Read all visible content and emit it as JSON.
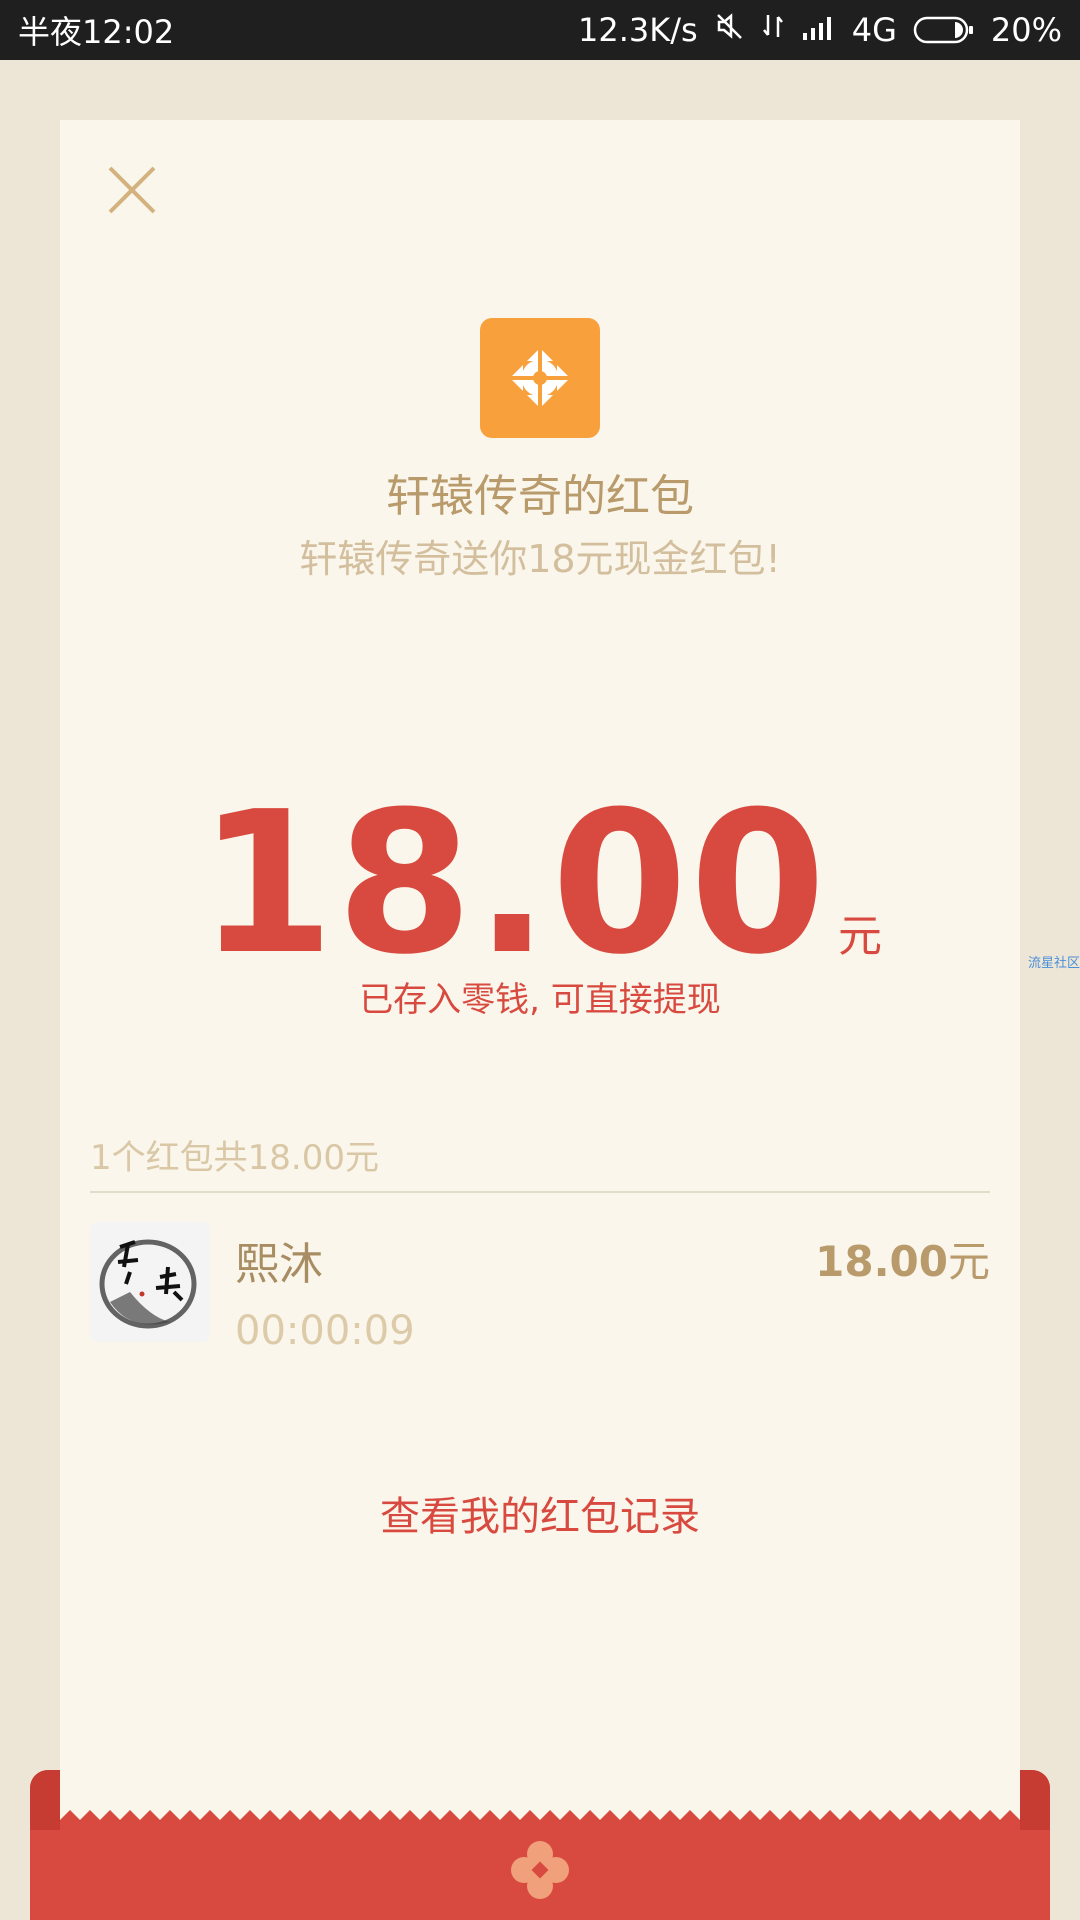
{
  "status_bar": {
    "time": "半夜12:02",
    "net_speed": "12.3K/s",
    "network": "4G",
    "battery": "20%"
  },
  "card": {
    "title": "轩辕传奇的红包",
    "subtitle": "轩辕传奇送你18元现金红包!",
    "amount": "18.00",
    "amount_unit": "元",
    "saved_note": "已存入零钱, 可直接提现",
    "summary": "1个红包共18.00元",
    "entry": {
      "name": "熙沐",
      "time": "00:00:09",
      "amount": "18.00",
      "amount_unit": "元"
    },
    "history_link": "查看我的红包记录"
  },
  "watermark": "流星社区",
  "colors": {
    "accent_red": "#d84a3f",
    "gold": "#b89a6b",
    "card_bg": "#faf6ec",
    "logo_orange": "#f7a03c"
  },
  "icons": {
    "close": "close-icon",
    "logo": "app-logo-icon",
    "seal": "envelope-seal-icon"
  }
}
